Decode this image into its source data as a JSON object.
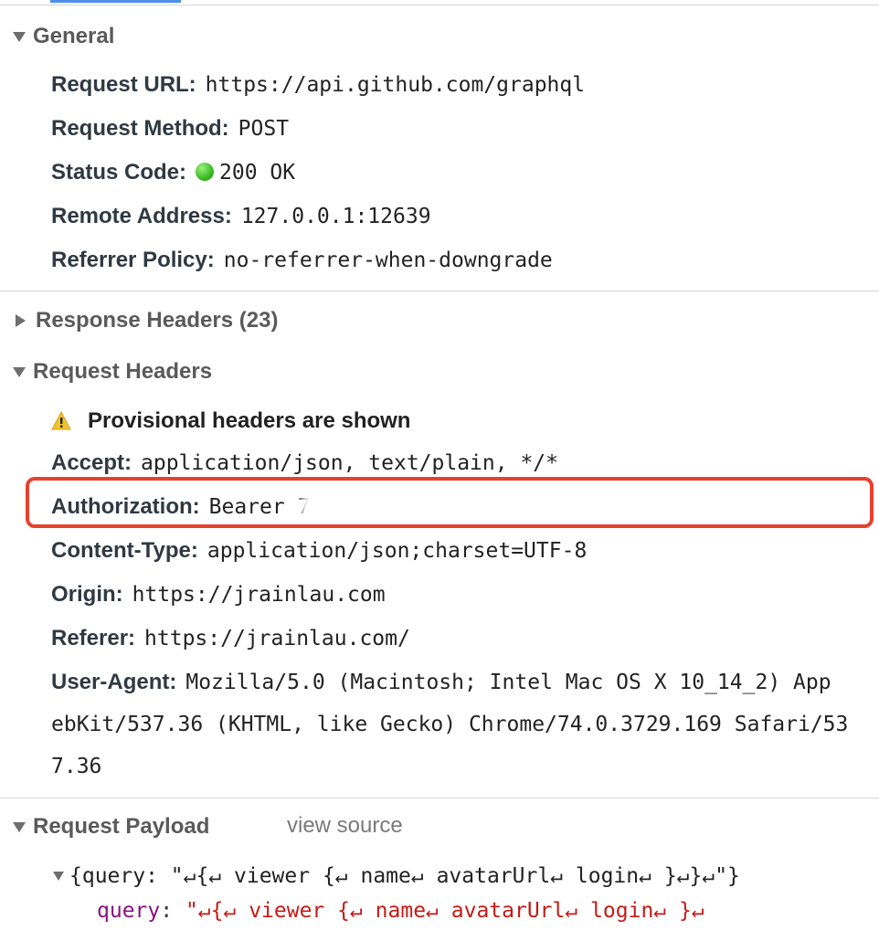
{
  "general": {
    "title": "General",
    "rows": [
      {
        "key": "Request URL:",
        "value": "https://api.github.com/graphql"
      },
      {
        "key": "Request Method:",
        "value": "POST"
      },
      {
        "key": "Status Code:",
        "value": "200 OK"
      },
      {
        "key": "Remote Address:",
        "value": "127.0.0.1:12639"
      },
      {
        "key": "Referrer Policy:",
        "value": "no-referrer-when-downgrade"
      }
    ]
  },
  "response_headers": {
    "title": "Response Headers (23)"
  },
  "request_headers": {
    "title": "Request Headers",
    "warning": "Provisional headers are shown",
    "rows": [
      {
        "key": "Accept:",
        "value": "application/json, text/plain, */*"
      },
      {
        "key": "Authorization:",
        "value": "Bearer 7"
      },
      {
        "key": "Content-Type:",
        "value": "application/json;charset=UTF-8"
      },
      {
        "key": "Origin:",
        "value": "https://jrainlau.com"
      },
      {
        "key": "Referer:",
        "value": "https://jrainlau.com/"
      },
      {
        "key": "User-Agent:",
        "value": "Mozilla/5.0 (Macintosh; Intel Mac OS X 10_14_2) App"
      }
    ],
    "ua_line2": "ebKit/537.36 (KHTML, like Gecko) Chrome/74.0.3729.169 Safari/53",
    "ua_line3": "7.36"
  },
  "request_payload": {
    "title": "Request Payload",
    "view_source": "view source",
    "summary": "{query: \"↵{↵ viewer {↵ name↵ avatarUrl↵ login↵ }↵}↵\"}",
    "query_key": "query",
    "query_value": "\"↵{↵  viewer {↵    name↵    avatarUrl↵    login↵  }↵"
  },
  "colors": {
    "status_ok": "#3fbf2a",
    "highlight": "#e8412e",
    "warning": "#f2c232"
  }
}
